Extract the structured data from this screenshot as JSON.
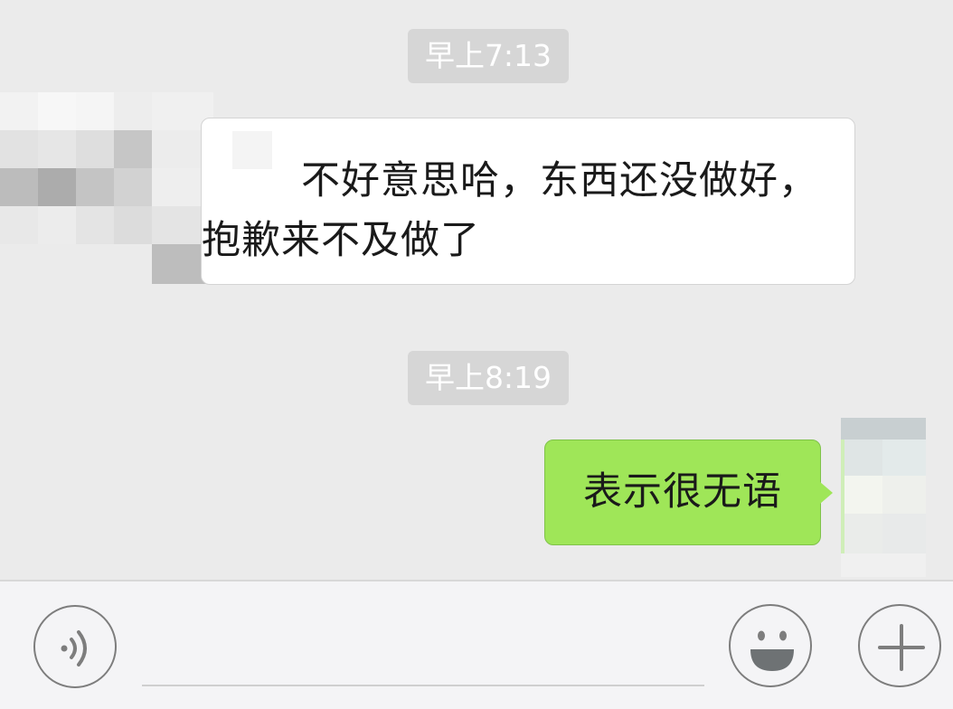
{
  "messages": [
    {
      "timestamp": "早上7:13",
      "direction": "incoming",
      "line1": "不好意思哈，东西还没做好，",
      "line2": "抱歉来不及做了"
    },
    {
      "timestamp": "早上8:19",
      "direction": "outgoing",
      "text": "表示很无语"
    }
  ],
  "input_bar": {
    "voice_icon": "voice-icon",
    "emoji_icon": "emoji-icon",
    "plus_icon": "plus-icon",
    "placeholder": ""
  },
  "colors": {
    "background": "#ebebeb",
    "incoming_bubble": "#ffffff",
    "outgoing_bubble": "#9fe658",
    "timestamp_bg": "#d6d6d6",
    "icon_stroke": "#7d7d7d"
  }
}
